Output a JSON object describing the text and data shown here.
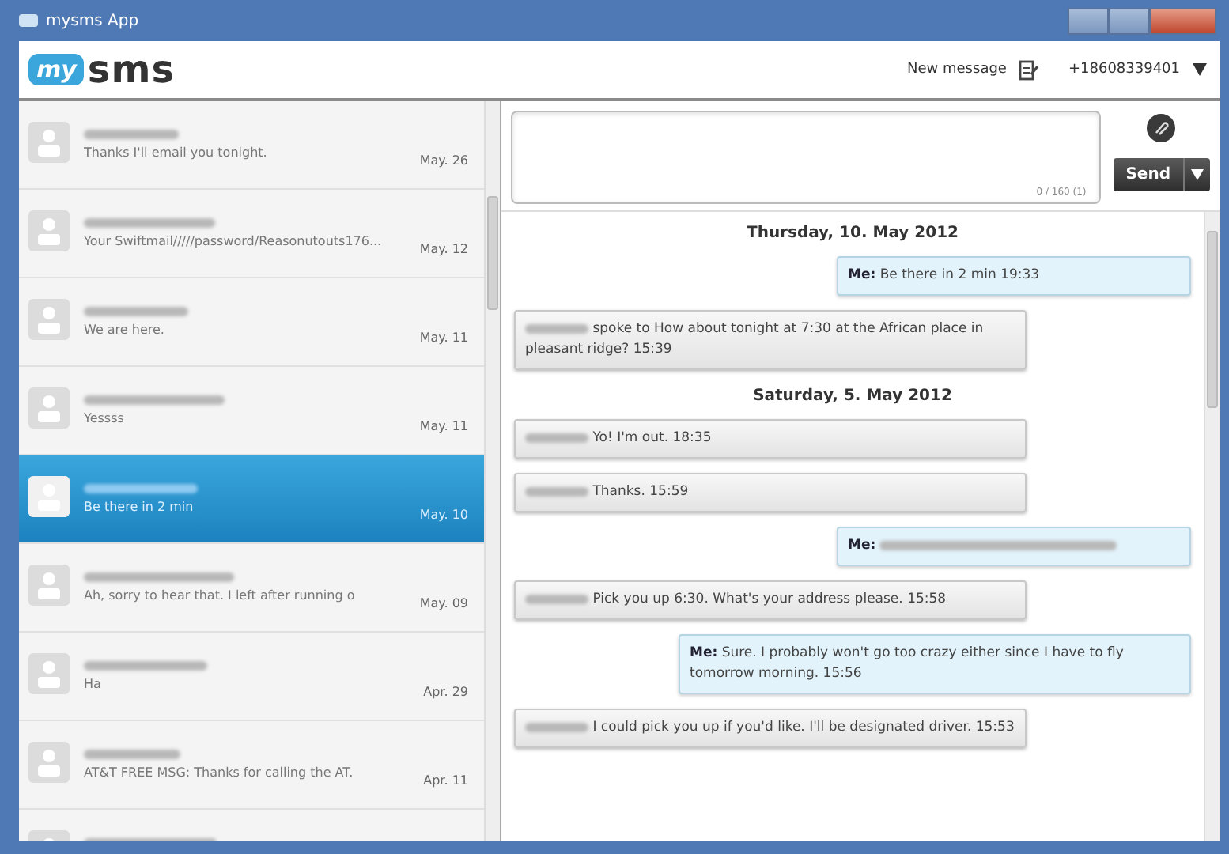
{
  "window": {
    "title": "mysms App"
  },
  "logo": {
    "badge": "my",
    "name": "sms"
  },
  "header": {
    "new_message": "New message",
    "phone": "+18608339401"
  },
  "conversations": [
    {
      "preview": "Thanks I'll email you tonight.",
      "date": "May. 26",
      "selected": false
    },
    {
      "preview": "Your Swiftmail/////password/Reasonutouts176...",
      "date": "May. 12",
      "selected": false
    },
    {
      "preview": "We are here.",
      "date": "May. 11",
      "selected": false
    },
    {
      "preview": "Yessss",
      "date": "May. 11",
      "selected": false
    },
    {
      "preview": "Be there in 2 min",
      "date": "May. 10",
      "selected": true
    },
    {
      "preview": "Ah, sorry to hear that. I left after running o",
      "date": "May. 09",
      "selected": false
    },
    {
      "preview": "Ha",
      "date": "Apr. 29",
      "selected": false
    },
    {
      "preview": "AT&T FREE MSG: Thanks for calling the AT.",
      "date": "Apr. 11",
      "selected": false
    },
    {
      "selected": false
    }
  ],
  "compose": {
    "counter": "0 / 160 (1)",
    "send": "Send"
  },
  "messages": [
    {
      "kind": "date",
      "text": "Thursday, 10. May 2012"
    },
    {
      "kind": "out",
      "sender": "Me:",
      "text": "Be there in 2 min 19:33"
    },
    {
      "kind": "in",
      "text": "spoke to How about tonight at 7:30 at the African place in pleasant ridge? 15:39"
    },
    {
      "kind": "date",
      "text": "Saturday, 5. May 2012"
    },
    {
      "kind": "in",
      "text": "Yo! I'm out. 18:35"
    },
    {
      "kind": "in",
      "text": "Thanks. 15:59"
    },
    {
      "kind": "out",
      "sender": "Me:"
    },
    {
      "kind": "in",
      "text": "Pick you up 6:30. What's your address please. 15:58"
    },
    {
      "kind": "out",
      "sender": "Me:",
      "text": "Sure. I probably won't go too crazy either since I have to fly tomorrow morning. 15:56"
    },
    {
      "kind": "in",
      "text": "I could pick you up if you'd like. I'll be designated driver. 15:53"
    }
  ]
}
